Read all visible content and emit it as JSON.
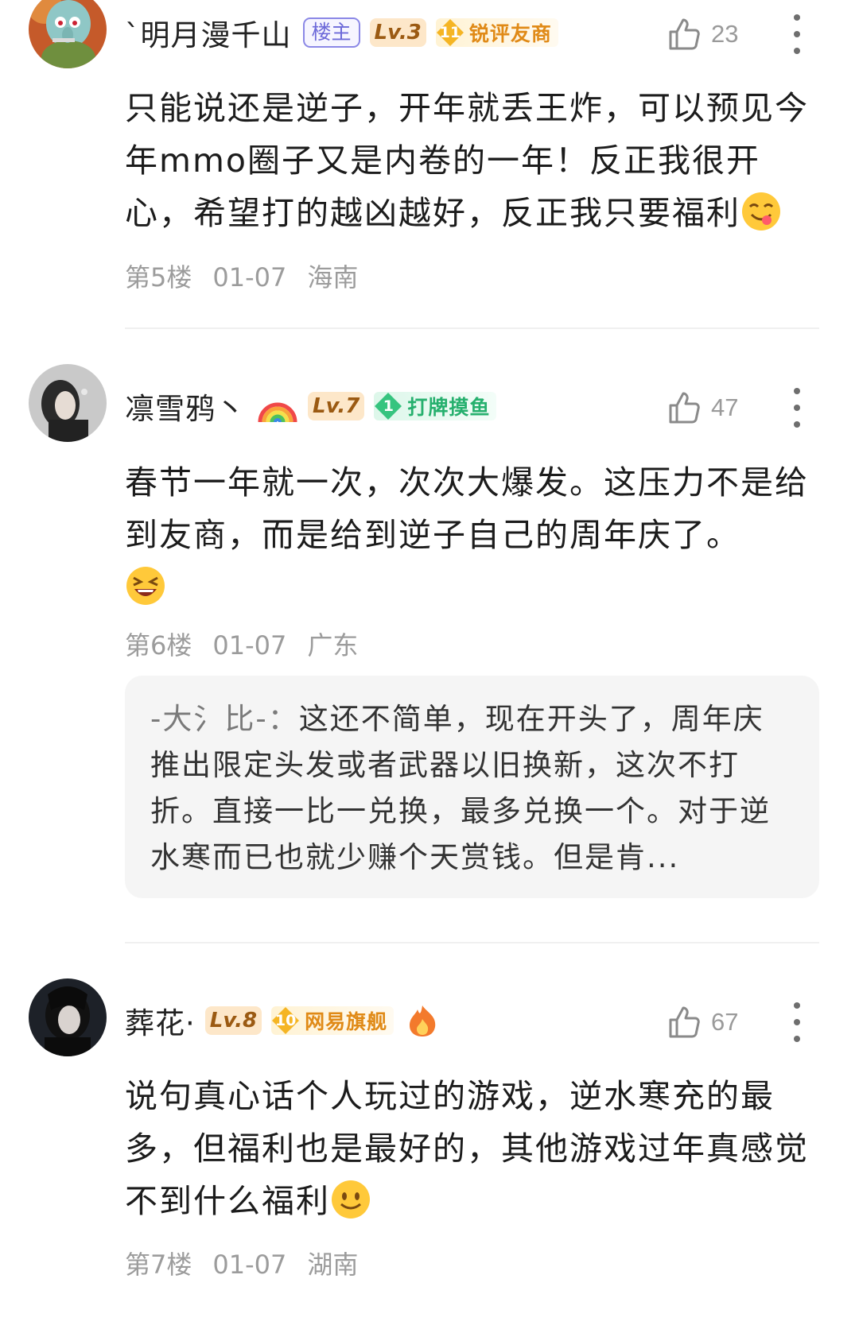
{
  "comments": [
    {
      "username": "`明月漫千山",
      "owner_badge": "楼主",
      "level": "Lv.3",
      "medal_level": "11",
      "medal_text": "锐评友商",
      "likes": "23",
      "text": "只能说还是逆子，开年就丢王炸，可以预见今年mmo圈子又是内卷的一年！反正我很开心，希望打的越凶越好，反正我只要福利",
      "floor": "第5楼",
      "date": "01-07",
      "location": "海南"
    },
    {
      "username": "凛雪鸦丶",
      "level": "Lv.7",
      "medal_level": "1",
      "medal_text": "打牌摸鱼",
      "likes": "47",
      "text": "春节一年就一次，次次大爆发。这压力不是给到友商，而是给到逆子自己的周年庆了。",
      "floor": "第6楼",
      "date": "01-07",
      "location": "广东",
      "reply": {
        "author": "-大氵比-：",
        "text": "这还不简单，现在开头了，周年庆推出限定头发或者武器以旧换新，这次不打折。直接一比一兑换，最多兑换一个。对于逆水寒而已也就少赚个天赏钱。但是肯..."
      }
    },
    {
      "username": "葬花·",
      "level": "Lv.8",
      "medal_level": "10",
      "medal_text": "网易旗舰",
      "likes": "67",
      "text": "说句真心话个人玩过的游戏，逆水寒充的最多，但福利也是最好的，其他游戏过年真感觉不到什么福利",
      "floor": "第7楼",
      "date": "01-07",
      "location": "湖南"
    }
  ],
  "colors": {
    "owner_badge": "#6d6ad9",
    "level_badge": "#9b5a12",
    "gold_medal": "#e08a17",
    "green_medal": "#26b06e",
    "meta_text": "#9c9c9c"
  },
  "icons": [
    "like-icon",
    "more-icon",
    "rainbow-icon",
    "fire-icon",
    "yum-emoji",
    "laugh-emoji",
    "smile-emoji"
  ]
}
